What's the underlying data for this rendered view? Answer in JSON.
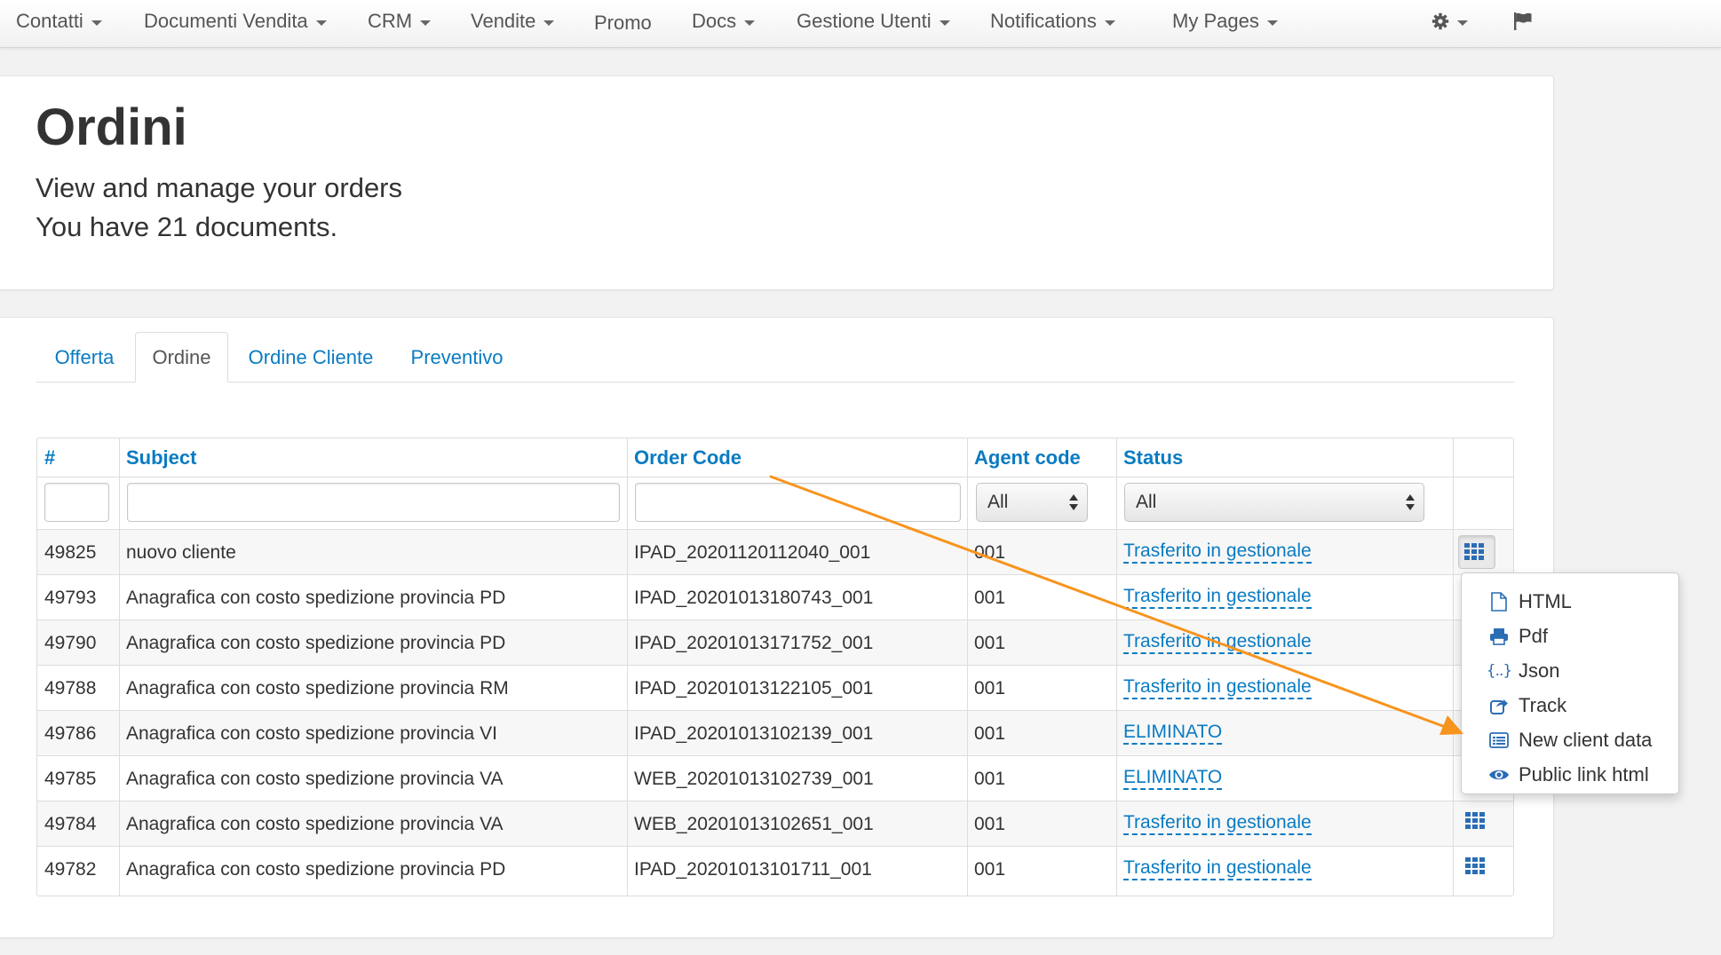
{
  "navbar": {
    "items": [
      {
        "label": "Contatti",
        "caret": true
      },
      {
        "label": "Documenti Vendita",
        "caret": true
      },
      {
        "label": "CRM",
        "caret": true
      },
      {
        "label": "Vendite",
        "caret": true
      },
      {
        "label": "Promo",
        "caret": false
      },
      {
        "label": "Docs",
        "caret": true
      },
      {
        "label": "Gestione Utenti",
        "caret": true
      },
      {
        "label": "Notifications",
        "caret": true
      },
      {
        "label": "My Pages",
        "caret": true
      }
    ],
    "settings_icon": "gear-icon",
    "flag_icon": "flag-icon"
  },
  "header": {
    "title": "Ordini",
    "subtitle": "View and manage your orders",
    "count_text": "You have 21 documents."
  },
  "tabs": [
    {
      "label": "Offerta",
      "active": false
    },
    {
      "label": "Ordine",
      "active": true
    },
    {
      "label": "Ordine Cliente",
      "active": false
    },
    {
      "label": "Preventivo",
      "active": false
    }
  ],
  "table": {
    "columns": [
      "#",
      "Subject",
      "Order Code",
      "Agent code",
      "Status"
    ],
    "filters": {
      "id": "",
      "subject": "",
      "order_code": "",
      "agent_code": "All",
      "status": "All"
    },
    "rows": [
      {
        "id": "49825",
        "subject": "nuovo cliente",
        "order_code": "IPAD_20201120112040_001",
        "agent_code": "001",
        "status": "Trasferito in gestionale"
      },
      {
        "id": "49793",
        "subject": "Anagrafica con costo spedizione provincia PD",
        "order_code": "IPAD_20201013180743_001",
        "agent_code": "001",
        "status": "Trasferito in gestionale"
      },
      {
        "id": "49790",
        "subject": "Anagrafica con costo spedizione provincia PD",
        "order_code": "IPAD_20201013171752_001",
        "agent_code": "001",
        "status": "Trasferito in gestionale"
      },
      {
        "id": "49788",
        "subject": "Anagrafica con costo spedizione provincia RM",
        "order_code": "IPAD_20201013122105_001",
        "agent_code": "001",
        "status": "Trasferito in gestionale"
      },
      {
        "id": "49786",
        "subject": "Anagrafica con costo spedizione provincia VI",
        "order_code": "IPAD_20201013102139_001",
        "agent_code": "001",
        "status": "ELIMINATO"
      },
      {
        "id": "49785",
        "subject": "Anagrafica con costo spedizione provincia VA",
        "order_code": "WEB_20201013102739_001",
        "agent_code": "001",
        "status": "ELIMINATO"
      },
      {
        "id": "49784",
        "subject": "Anagrafica con costo spedizione provincia VA",
        "order_code": "WEB_20201013102651_001",
        "agent_code": "001",
        "status": "Trasferito in gestionale"
      },
      {
        "id": "49782",
        "subject": "Anagrafica con costo spedizione provincia PD",
        "order_code": "IPAD_20201013101711_001",
        "agent_code": "001",
        "status": "Trasferito in gestionale"
      }
    ]
  },
  "actions_menu": {
    "items": [
      {
        "label": "HTML",
        "icon": "file-icon"
      },
      {
        "label": "Pdf",
        "icon": "print-icon"
      },
      {
        "label": "Json",
        "icon": "json-icon"
      },
      {
        "label": "Track",
        "icon": "share-icon"
      },
      {
        "label": "New client data",
        "icon": "list-alt-icon"
      },
      {
        "label": "Public link html",
        "icon": "eye-icon"
      }
    ]
  },
  "colors": {
    "link": "#0a7bc2",
    "annotation_arrow": "#f7941d"
  }
}
